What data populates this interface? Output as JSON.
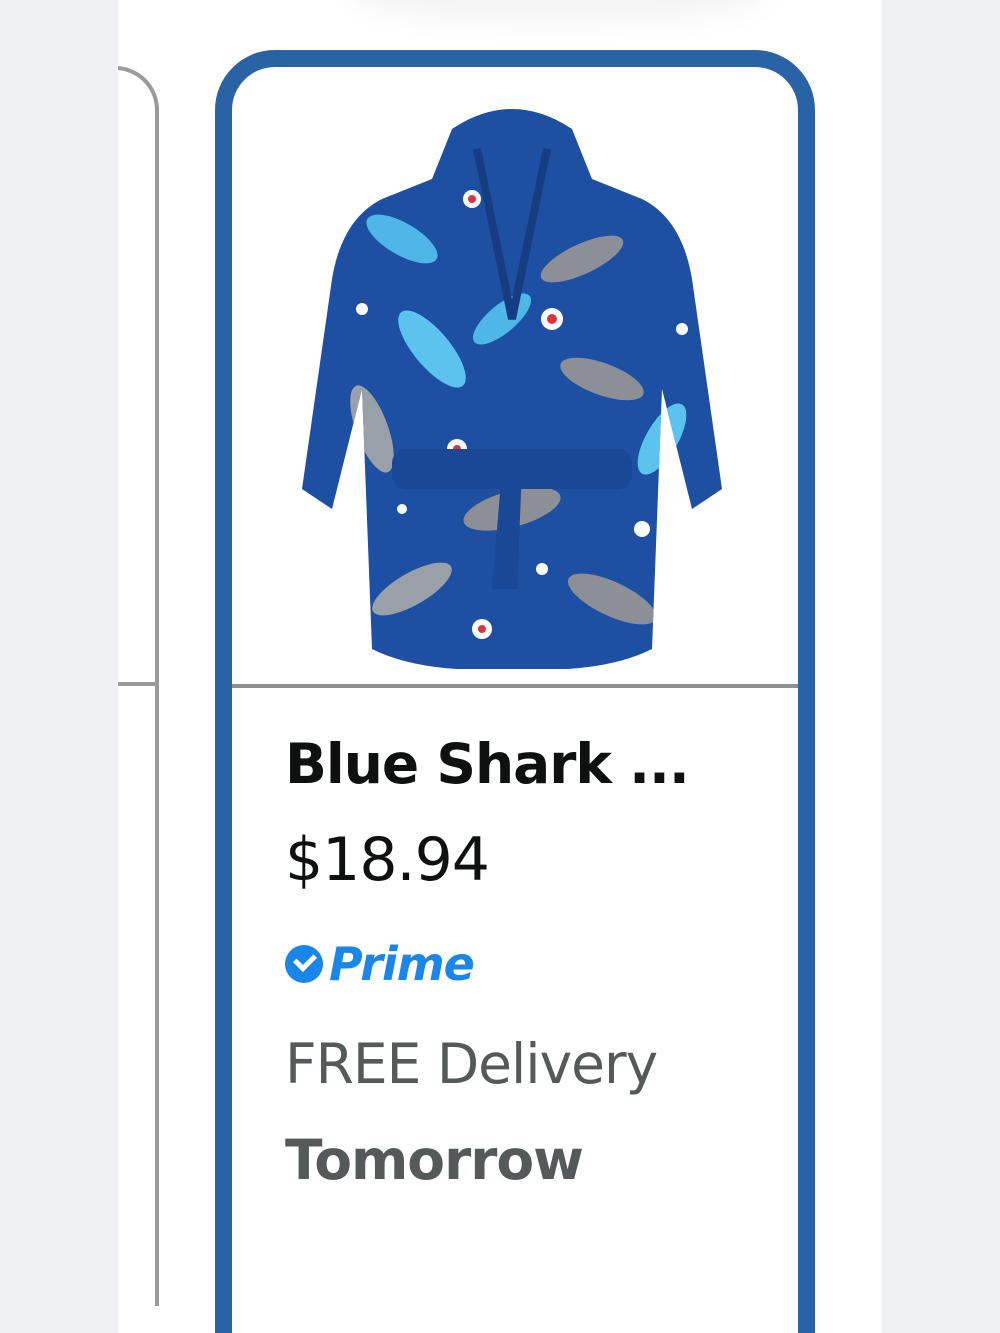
{
  "product_card": {
    "image_alt": "Blue kids hooded robe with shark print",
    "title": "Blue Shark ...",
    "price": "$18.94",
    "prime_label": "Prime",
    "delivery_line": "FREE Delivery",
    "delivery_day": "Tomorrow"
  },
  "colors": {
    "card_border": "#2a62a6",
    "prime_blue": "#1a86ea",
    "robe_blue": "#1d4fa3"
  },
  "icons": {
    "prime_check": "prime-check-icon"
  }
}
